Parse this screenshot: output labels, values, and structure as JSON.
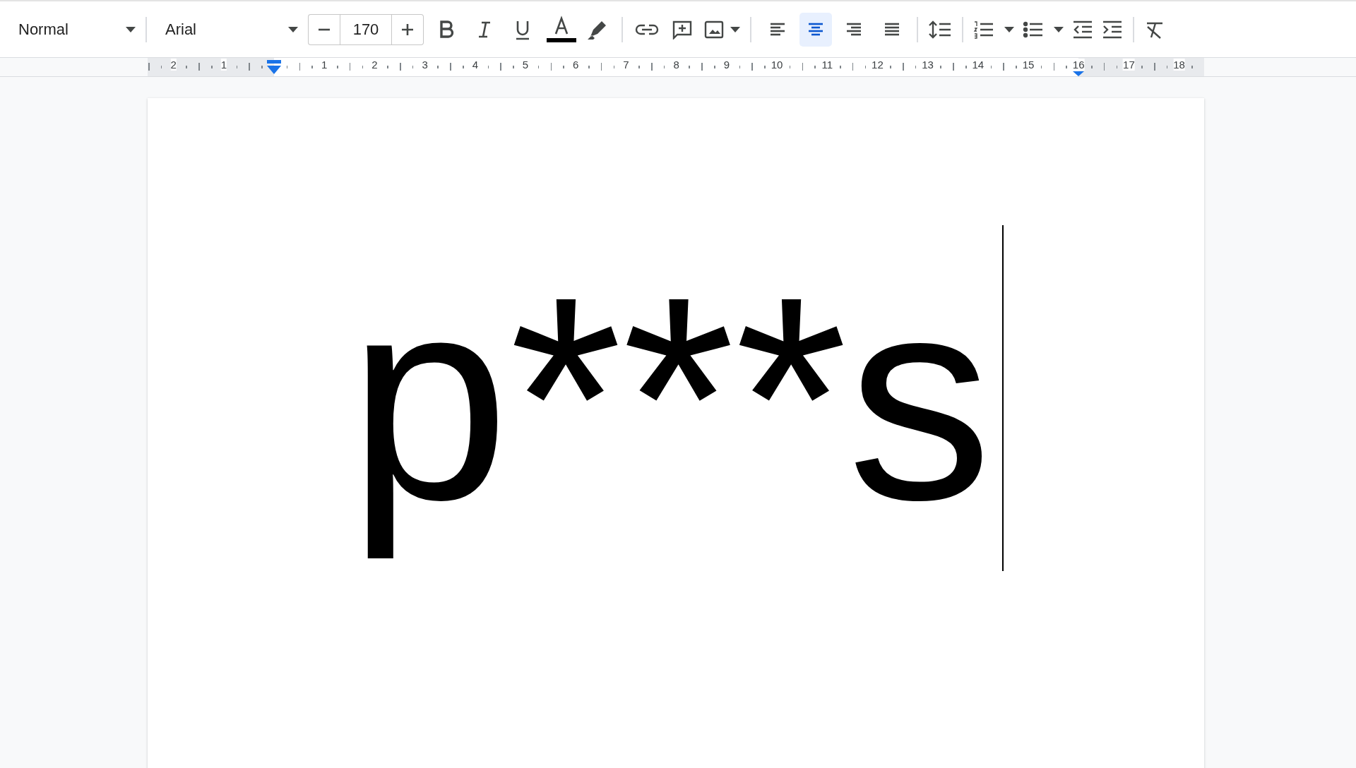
{
  "toolbar": {
    "paragraph_style": {
      "value": "Normal"
    },
    "font": {
      "value": "Arial"
    },
    "font_size": {
      "value": "170"
    },
    "text_format": [
      {
        "kind": "bold",
        "selected": false
      },
      {
        "kind": "italic",
        "selected": false
      },
      {
        "kind": "underline",
        "selected": false
      }
    ],
    "text_color": {
      "color": "#000000"
    },
    "alignment": [
      {
        "kind": "left",
        "selected": false
      },
      {
        "kind": "center",
        "selected": true
      },
      {
        "kind": "right",
        "selected": false
      },
      {
        "kind": "justify",
        "selected": false
      }
    ]
  },
  "ruler": {
    "labels": [
      "2",
      "1",
      "1",
      "2",
      "3",
      "4",
      "5",
      "6",
      "7",
      "8",
      "9",
      "10",
      "11",
      "12",
      "13",
      "14",
      "15",
      "16",
      "17",
      "18"
    ]
  },
  "document": {
    "text": "p***s"
  }
}
